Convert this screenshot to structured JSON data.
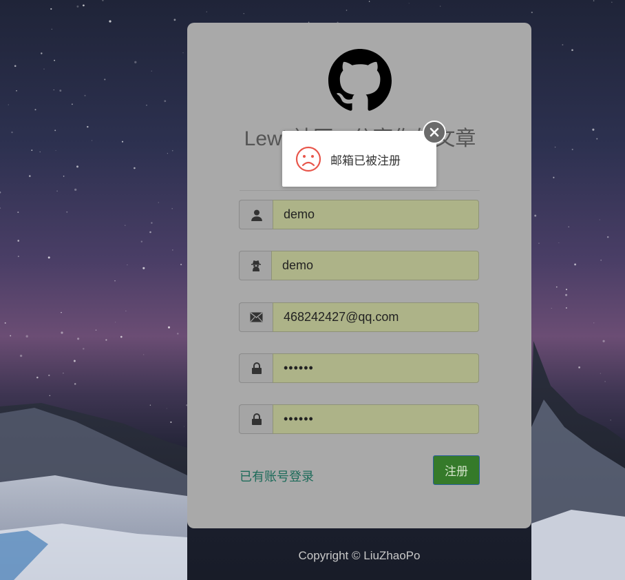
{
  "brand": {
    "logo_icon": "github-octocat-icon",
    "site_title": "Lewi 社区 · 分享你的文章"
  },
  "form": {
    "username": {
      "icon": "user-icon",
      "value": "demo"
    },
    "nickname": {
      "icon": "incognito-icon",
      "value": "demo"
    },
    "email": {
      "icon": "envelope-icon",
      "value": "468242427@qq.com"
    },
    "password": {
      "icon": "lock-icon",
      "value": "••••••"
    },
    "confirm_password": {
      "icon": "lock-icon",
      "value": "••••••"
    },
    "login_link": "已有账号登录",
    "register_button": "注册"
  },
  "toast": {
    "icon": "sad-face-icon",
    "message": "邮箱已被注册",
    "close_icon": "close-icon"
  },
  "footer": {
    "copyright": "Copyright © LiuZhaoPo"
  },
  "colors": {
    "card": "#a9a9a9",
    "input_autofill": "#adb388",
    "button": "#357a2a",
    "link": "#1d6b5a",
    "error_icon": "#e8564b"
  }
}
